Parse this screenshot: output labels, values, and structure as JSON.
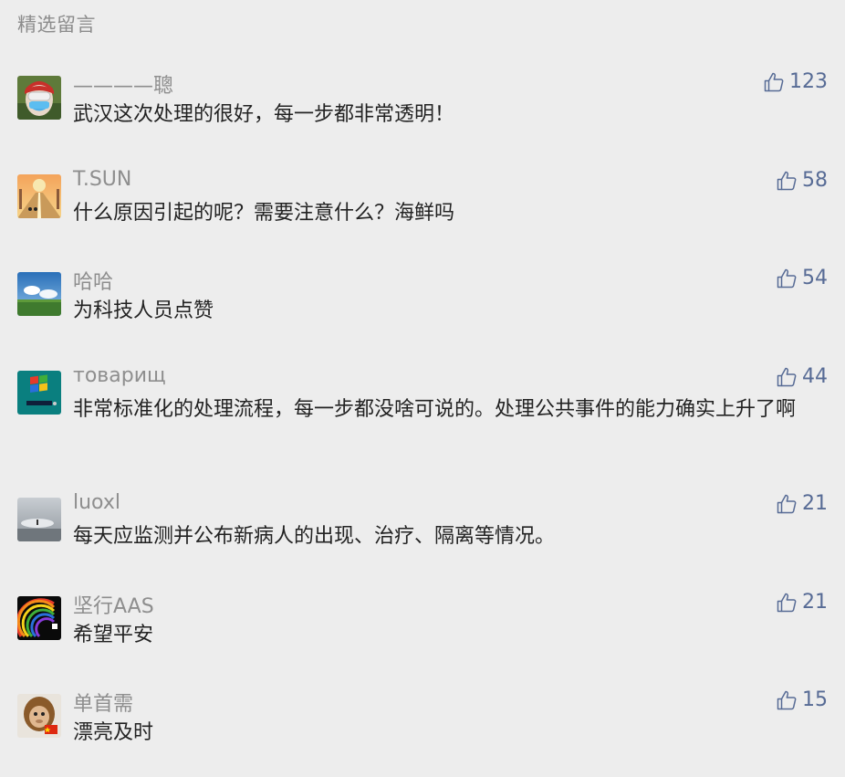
{
  "section": {
    "title": "精选留言"
  },
  "colors": {
    "like": "#576b95",
    "nickname": "#8e8e8e",
    "content": "#222222",
    "background": "#ededed"
  },
  "comments": [
    {
      "nickname": "————聰",
      "content": "武汉这次处理的很好，每一步都非常透明！",
      "likes": "123",
      "avatar_icon": "masked-person-avatar"
    },
    {
      "nickname": "T.SUN",
      "content": "什么原因引起的呢？需要注意什么？海鲜吗",
      "likes": "58",
      "avatar_icon": "sunset-road-avatar"
    },
    {
      "nickname": "哈哈",
      "content": "为科技人员点赞",
      "likes": "54",
      "avatar_icon": "landscape-avatar"
    },
    {
      "nickname": "товарищ",
      "content": "非常标准化的处理流程，每一步都没啥可说的。处理公共事件的能力确实上升了啊",
      "likes": "44",
      "avatar_icon": "windows95-avatar"
    },
    {
      "nickname": "luoxl",
      "content": "每天应监测并公布新病人的出现、治疗、隔离等情况。",
      "likes": "21",
      "avatar_icon": "misty-beach-avatar"
    },
    {
      "nickname": "坚行AAS",
      "content": "希望平安",
      "likes": "21",
      "avatar_icon": "rainbow-avatar"
    },
    {
      "nickname": "单首需",
      "content": "漂亮及时",
      "likes": "15",
      "avatar_icon": "monkey-avatar"
    }
  ]
}
